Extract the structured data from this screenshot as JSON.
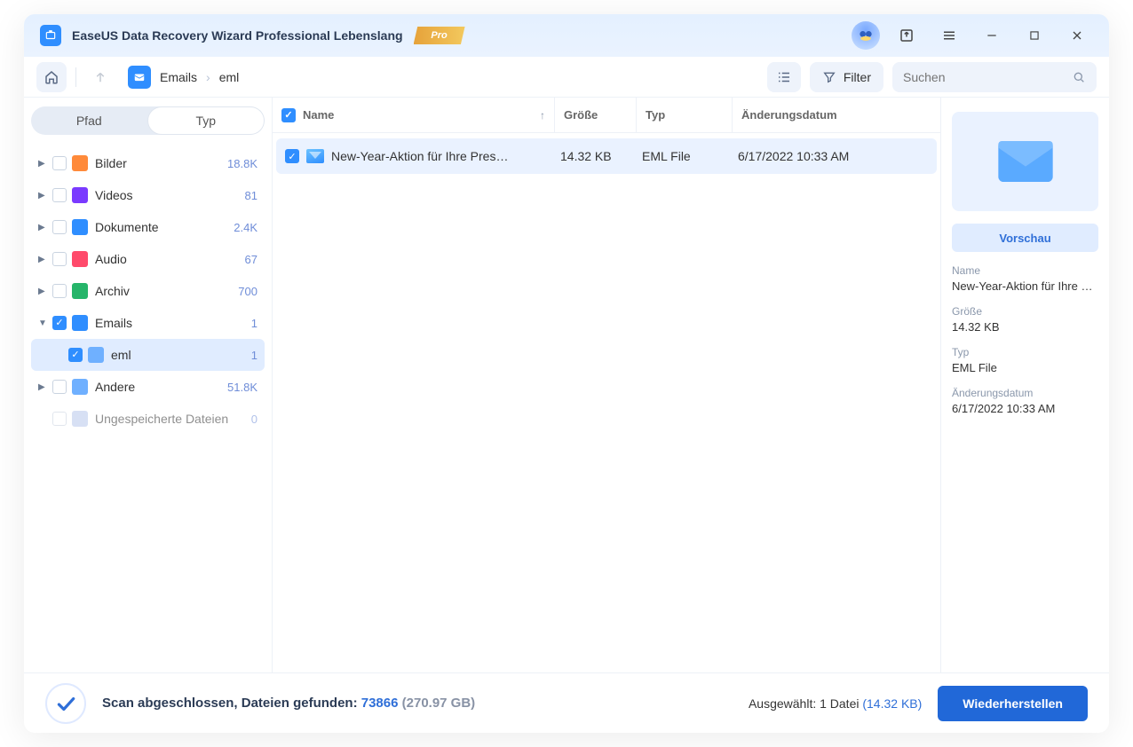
{
  "app": {
    "title": "EaseUS Data Recovery Wizard Professional Lebenslang",
    "pro_label": "Pro"
  },
  "toolbar": {
    "filter_label": "Filter"
  },
  "search": {
    "placeholder": "Suchen"
  },
  "breadcrumb": {
    "items": [
      "Emails",
      "eml"
    ]
  },
  "sidebar": {
    "tab_path": "Pfad",
    "tab_type": "Typ",
    "items": [
      {
        "label": "Bilder",
        "count": "18.8K",
        "icon": "#ff8a3a",
        "expanded": false,
        "checked": false
      },
      {
        "label": "Videos",
        "count": "81",
        "icon": "#7a3aff",
        "expanded": false,
        "checked": false
      },
      {
        "label": "Dokumente",
        "count": "2.4K",
        "icon": "#2f8eff",
        "expanded": false,
        "checked": false
      },
      {
        "label": "Audio",
        "count": "67",
        "icon": "#ff4a6b",
        "expanded": false,
        "checked": false
      },
      {
        "label": "Archiv",
        "count": "700",
        "icon": "#26b56a",
        "expanded": false,
        "checked": false
      },
      {
        "label": "Emails",
        "count": "1",
        "icon": "#2f8eff",
        "expanded": true,
        "checked": true,
        "children": [
          {
            "label": "eml",
            "count": "1",
            "checked": true,
            "selected": true
          }
        ]
      },
      {
        "label": "Andere",
        "count": "51.8K",
        "icon": "#6fb0ff",
        "expanded": false,
        "checked": false
      },
      {
        "label": "Ungespeicherte Dateien",
        "count": "0",
        "icon": "#b7c8ec",
        "disabled": true,
        "checked": false
      }
    ]
  },
  "columns": {
    "name": "Name",
    "size": "Größe",
    "type": "Typ",
    "date": "Änderungsdatum"
  },
  "rows": [
    {
      "name": "New-Year-Aktion für Ihre Pressemit…",
      "size": "14.32 KB",
      "type": "EML File",
      "date": "6/17/2022 10:33 AM",
      "checked": true
    }
  ],
  "preview": {
    "button": "Vorschau",
    "fields": {
      "name_label": "Name",
      "name_value": "New-Year-Aktion für Ihre …",
      "size_label": "Größe",
      "size_value": "14.32 KB",
      "type_label": "Typ",
      "type_value": "EML File",
      "date_label": "Änderungsdatum",
      "date_value": "6/17/2022 10:33 AM"
    }
  },
  "footer": {
    "scan_prefix": "Scan abgeschlossen, Dateien gefunden: ",
    "scan_count": "73866",
    "scan_size": " (270.97 GB)",
    "selected_prefix": "Ausgewählt: 1 Datei ",
    "selected_size": "(14.32 KB)",
    "recover_label": "Wiederherstellen"
  }
}
